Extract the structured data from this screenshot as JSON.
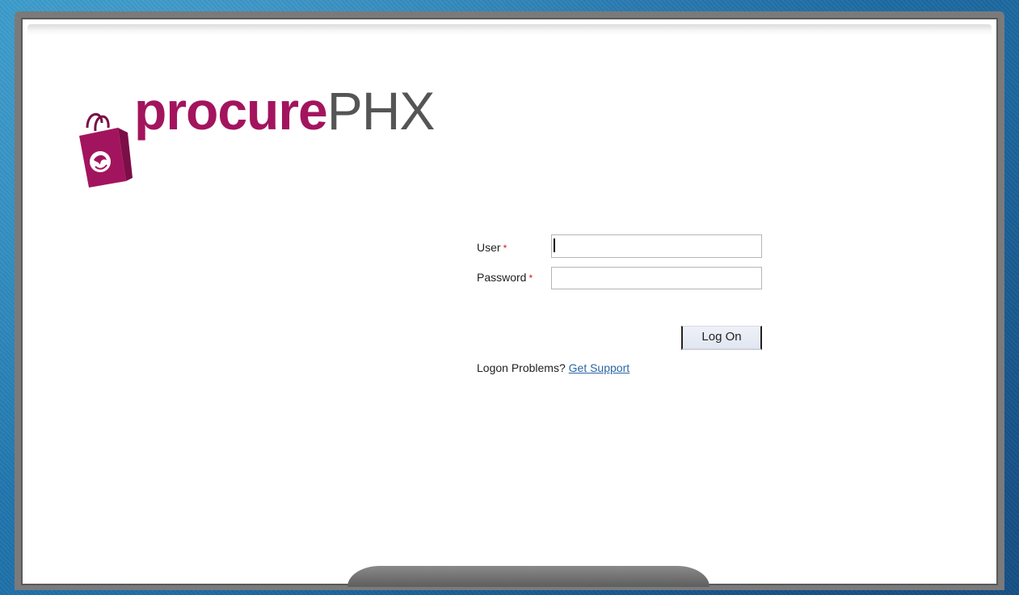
{
  "logo": {
    "part1": "procure",
    "part2": "PHX",
    "bag_icon": "shopping-bag-phoenix-icon"
  },
  "form": {
    "user_label": "User",
    "password_label": "Password",
    "required_mark": "*",
    "user_value": "",
    "password_value": "",
    "logon_button": "Log On"
  },
  "support": {
    "prompt": "Logon Problems?",
    "link": "Get Support"
  },
  "colors": {
    "brand": "#a3145e",
    "link": "#2b66a3",
    "required": "#d11111"
  }
}
